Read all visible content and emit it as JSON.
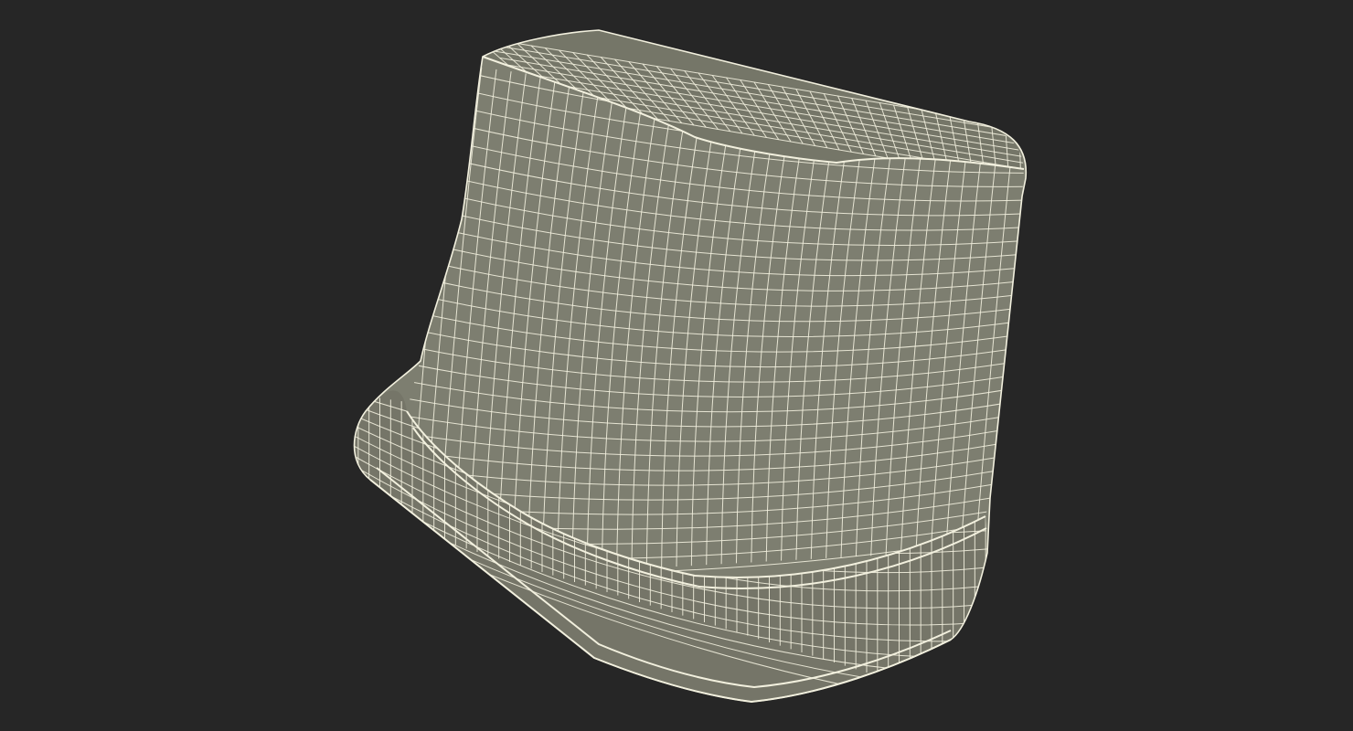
{
  "scene": {
    "background_color": "#262626",
    "surface_color": "#7d7e70",
    "surface_shade_color": "#6f7063",
    "wire_color": "#f2f0de",
    "object": "wireframe-mesh"
  }
}
